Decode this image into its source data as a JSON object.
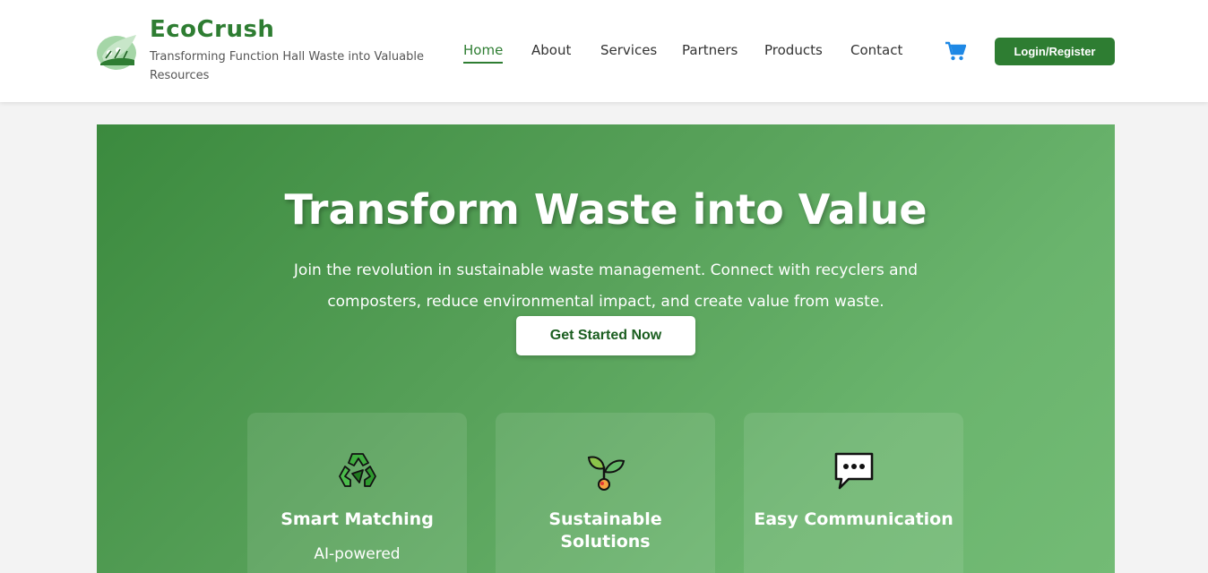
{
  "brand": {
    "name": "EcoCrush",
    "tagline": "Transforming Function Hall Waste into Valuable Resources"
  },
  "nav": {
    "items": [
      {
        "label": "Home",
        "active": true
      },
      {
        "label": "About",
        "active": false
      },
      {
        "label": "Services",
        "active": false
      },
      {
        "label": "Partners",
        "active": false
      },
      {
        "label": "Products",
        "active": false
      },
      {
        "label": "Contact",
        "active": false
      }
    ],
    "cart_icon": "shopping-cart-icon",
    "login_label": "Login/Register"
  },
  "hero": {
    "title": "Transform Waste into Value",
    "subtitle": "Join the revolution in sustainable waste management. Connect with recyclers and composters, reduce environmental impact, and create value from waste.",
    "cta_label": "Get Started Now"
  },
  "features": [
    {
      "icon": "recycle-icon",
      "title": "Smart Matching",
      "desc": "AI-powered"
    },
    {
      "icon": "seedling-icon",
      "title": "Sustainable Solutions",
      "desc": ""
    },
    {
      "icon": "speech-bubble-icon",
      "title": "Easy Communication",
      "desc": ""
    }
  ],
  "colors": {
    "brand_green": "#2e7d32",
    "hero_gradient_start": "#3b8a3e",
    "hero_gradient_end": "#73bb75",
    "cart_blue": "#1e88e5"
  }
}
